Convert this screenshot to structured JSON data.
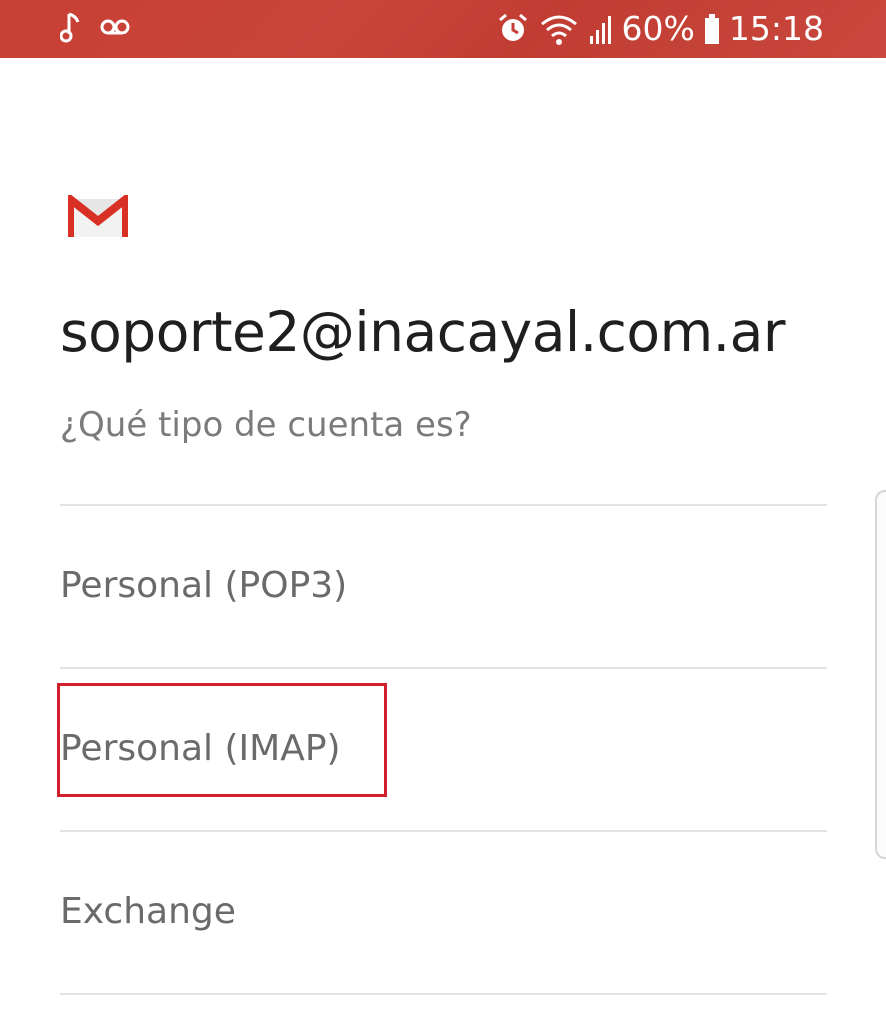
{
  "status_bar": {
    "battery_percent": "60%",
    "time": "15:18",
    "left_icons": [
      "music-note-icon",
      "voicemail-icon"
    ],
    "right_icons": [
      "alarm-icon",
      "wifi-icon",
      "signal-icon",
      "battery-icon"
    ],
    "background_color": "#c73f35"
  },
  "account": {
    "email": "soporte2@inacayal.com.ar",
    "question": "¿Qué tipo de cuenta es?"
  },
  "options": [
    {
      "label": "Personal (POP3)"
    },
    {
      "label": "Personal (IMAP)",
      "highlighted": true
    },
    {
      "label": "Exchange"
    }
  ],
  "colors": {
    "highlight_border": "#d11f2d",
    "gmail_red": "#d93025"
  }
}
